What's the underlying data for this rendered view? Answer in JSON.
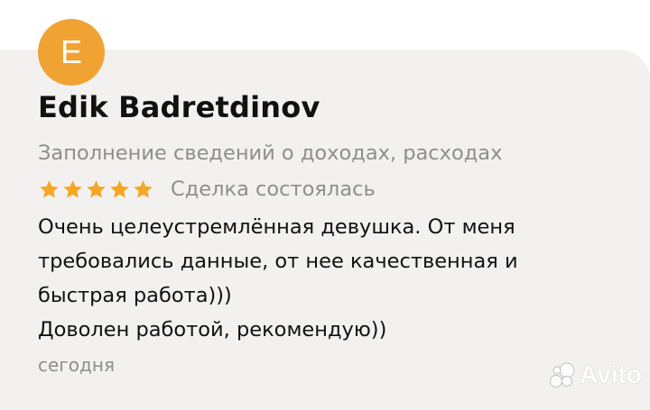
{
  "review": {
    "avatar_letter": "E",
    "author_name": "Edik Badretdinov",
    "service": "Заполнение сведений о доходах, расходах",
    "rating": 5,
    "rating_max": 5,
    "deal_status": "Сделка состоялась",
    "text_lines": [
      "Очень целеустремлённая девушка. От меня",
      "требовались данные, от нее качественная и",
      "быстрая работа)))",
      "Доволен работой, рекомендую))"
    ],
    "date": "сегодня"
  },
  "watermark": {
    "text": "Avito"
  },
  "colors": {
    "avatar": "#f0a333",
    "star": "#f5a623",
    "card_background": "#f2f1ef",
    "muted_text": "#8e8e8e",
    "primary_text": "#111111"
  },
  "icons": {
    "rating": "star-icon",
    "logo": "avito-logo-icon"
  }
}
